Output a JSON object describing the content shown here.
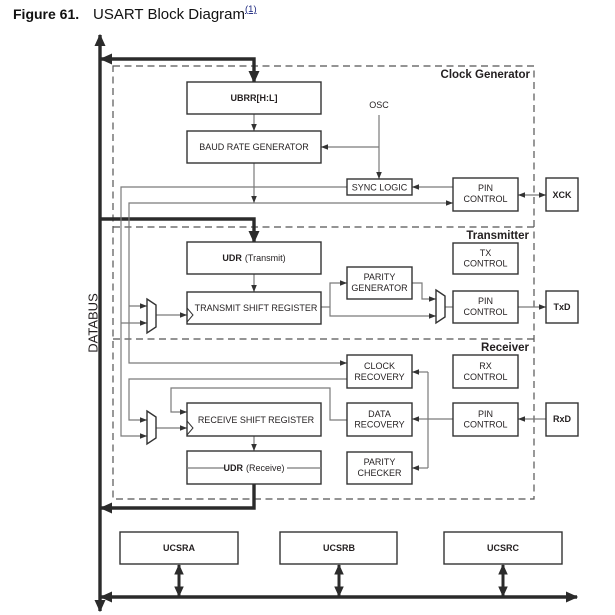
{
  "figure": {
    "number_label": "Figure 61.",
    "title": "USART Block Diagram",
    "footnote_ref": "(1)"
  },
  "databus_label": "DATABUS",
  "sections": {
    "clock_generator": "Clock Generator",
    "transmitter": "Transmitter",
    "receiver": "Receiver"
  },
  "clock_generator": {
    "ubrr": "UBRR[H:L]",
    "baud_rate_generator": "BAUD RATE GENERATOR",
    "osc": "OSC",
    "sync_logic": "SYNC LOGIC",
    "pin_control": [
      "PIN",
      "CONTROL"
    ],
    "pin": "XCK"
  },
  "transmitter": {
    "udr": {
      "name": "UDR",
      "qualifier": "(Transmit)"
    },
    "shift_register": "TRANSMIT SHIFT REGISTER",
    "parity_generator": [
      "PARITY",
      "GENERATOR"
    ],
    "tx_control": [
      "TX",
      "CONTROL"
    ],
    "pin_control": [
      "PIN",
      "CONTROL"
    ],
    "pin": "TxD"
  },
  "receiver": {
    "clock_recovery": [
      "CLOCK",
      "RECOVERY"
    ],
    "rx_control": [
      "RX",
      "CONTROL"
    ],
    "shift_register": "RECEIVE SHIFT REGISTER",
    "data_recovery": [
      "DATA",
      "RECOVERY"
    ],
    "pin_control": [
      "PIN",
      "CONTROL"
    ],
    "pin": "RxD",
    "udr": {
      "name": "UDR",
      "qualifier": "(Receive)"
    },
    "parity_checker": [
      "PARITY",
      "CHECKER"
    ]
  },
  "control_registers": [
    "UCSRA",
    "UCSRB",
    "UCSRC"
  ],
  "colors": {
    "box_stroke": "#333333",
    "wire": "#7a7a7a",
    "bus": "#2b2b2b",
    "dashed_border": "#555555",
    "footnote_link": "#1f2a80"
  }
}
